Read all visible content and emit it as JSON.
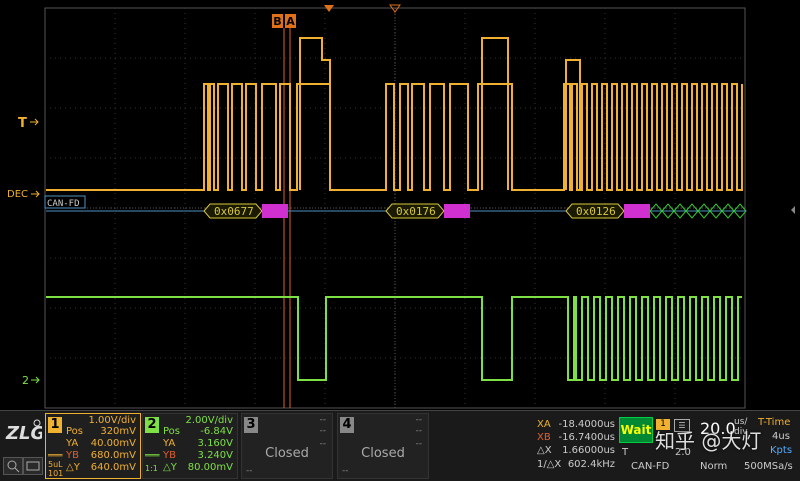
{
  "colors": {
    "ch1": "#f0b030",
    "ch2": "#7de045",
    "grid": "#3a3a3a",
    "decode_fill": "#d8c83a",
    "marker": "#e0701a",
    "magenta": "#d030d0",
    "cursor": "#e06030"
  },
  "markers": {
    "ch1_label": "T",
    "dec_label": "DEC",
    "ch2_label": "2",
    "cursor_b": "B",
    "cursor_a": "A"
  },
  "decode": {
    "bus_label": "CAN-FD",
    "frames": [
      "0x0677",
      "0x0176",
      "0x0126"
    ]
  },
  "ch1": {
    "num": "1",
    "vdiv": "1.00V/div",
    "pos_k": "Pos",
    "pos_v": "320mV",
    "ya_k": "YA",
    "ya_v": "40.00mV",
    "yb_k": "YB",
    "yb_v": "680.0mV",
    "dy_k": "△Y",
    "dy_v": "640.0mV",
    "side_top": "5uL",
    "side_bot": "101"
  },
  "ch2": {
    "num": "2",
    "vdiv": "2.00V/div",
    "pos_k": "Pos",
    "pos_v": "-6.84V",
    "ya_k": "YA",
    "ya_v": "3.160V",
    "yb_k": "YB",
    "yb_v": "3.240V",
    "dy_k": "△Y",
    "dy_v": "80.00mV",
    "side": "1:1"
  },
  "ch3": {
    "num": "3",
    "status": "Closed",
    "dash1": "--",
    "dash2": "--",
    "dash3": "--",
    "dash4": "--"
  },
  "ch4": {
    "num": "4",
    "status": "Closed",
    "dash1": "--",
    "dash2": "--",
    "dash3": "--",
    "dash4": "--"
  },
  "meas": {
    "xa_k": "XA",
    "xa_v": "-18.4000us",
    "xb_k": "XB",
    "xb_v": "-16.7400us",
    "dx_k": "△X",
    "dx_v": "1.66000us",
    "idx_k": "1/△X",
    "idx_v": "602.4kHz"
  },
  "trigger": {
    "state": "Wait",
    "source_num": "1",
    "mode": "T",
    "type": "CAN-FD",
    "value": "2.0"
  },
  "timebase": {
    "value": "20.0",
    "unit_top": "us/",
    "unit_bot": "div",
    "mode_title": "T-Time",
    "offset": "4us",
    "sample_k": "Kpts",
    "norm": "Norm",
    "rate": "500MSa/s"
  },
  "watermark": "知乎 @大灯"
}
